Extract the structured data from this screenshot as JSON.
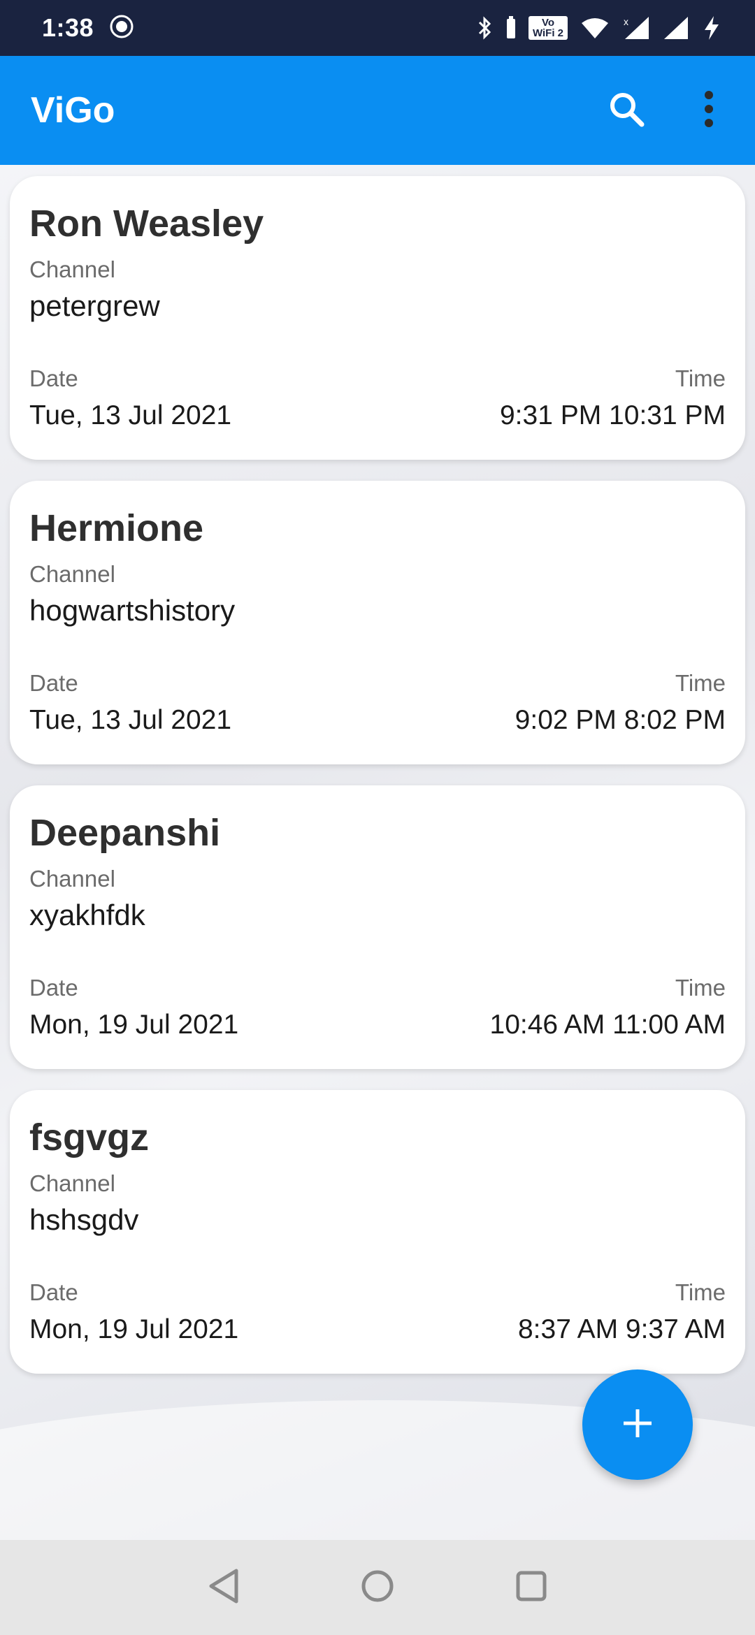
{
  "status_bar": {
    "time": "1:38",
    "vowifi_line1": "Vo",
    "vowifi_line2": "WiFi 2"
  },
  "app_bar": {
    "title": "ViGo",
    "icons": [
      "search-icon",
      "more-vert-icon"
    ]
  },
  "labels": {
    "channel": "Channel",
    "date": "Date",
    "time": "Time"
  },
  "meetings": [
    {
      "name": "Ron Weasley",
      "channel": "petergrew",
      "date": "Tue, 13 Jul 2021",
      "time": "9:31 PM 10:31 PM"
    },
    {
      "name": "Hermione",
      "channel": "hogwartshistory",
      "date": "Tue, 13 Jul 2021",
      "time": "9:02 PM 8:02 PM"
    },
    {
      "name": "Deepanshi",
      "channel": "xyakhfdk",
      "date": "Mon, 19 Jul 2021",
      "time": "10:46 AM 11:00 AM"
    },
    {
      "name": "fsgvgz",
      "channel": "hshsgdv",
      "date": "Mon, 19 Jul 2021",
      "time": "8:37 AM 9:37 AM"
    }
  ],
  "fab": {
    "icon": "plus-icon"
  },
  "nav_bar": {
    "icons": [
      "back-icon",
      "home-icon",
      "recents-icon"
    ]
  },
  "colors": {
    "status_bar": "#1a2340",
    "app_bar": "#0a8ef2",
    "fab": "#0a8ef2",
    "card_bg": "#ffffff"
  }
}
